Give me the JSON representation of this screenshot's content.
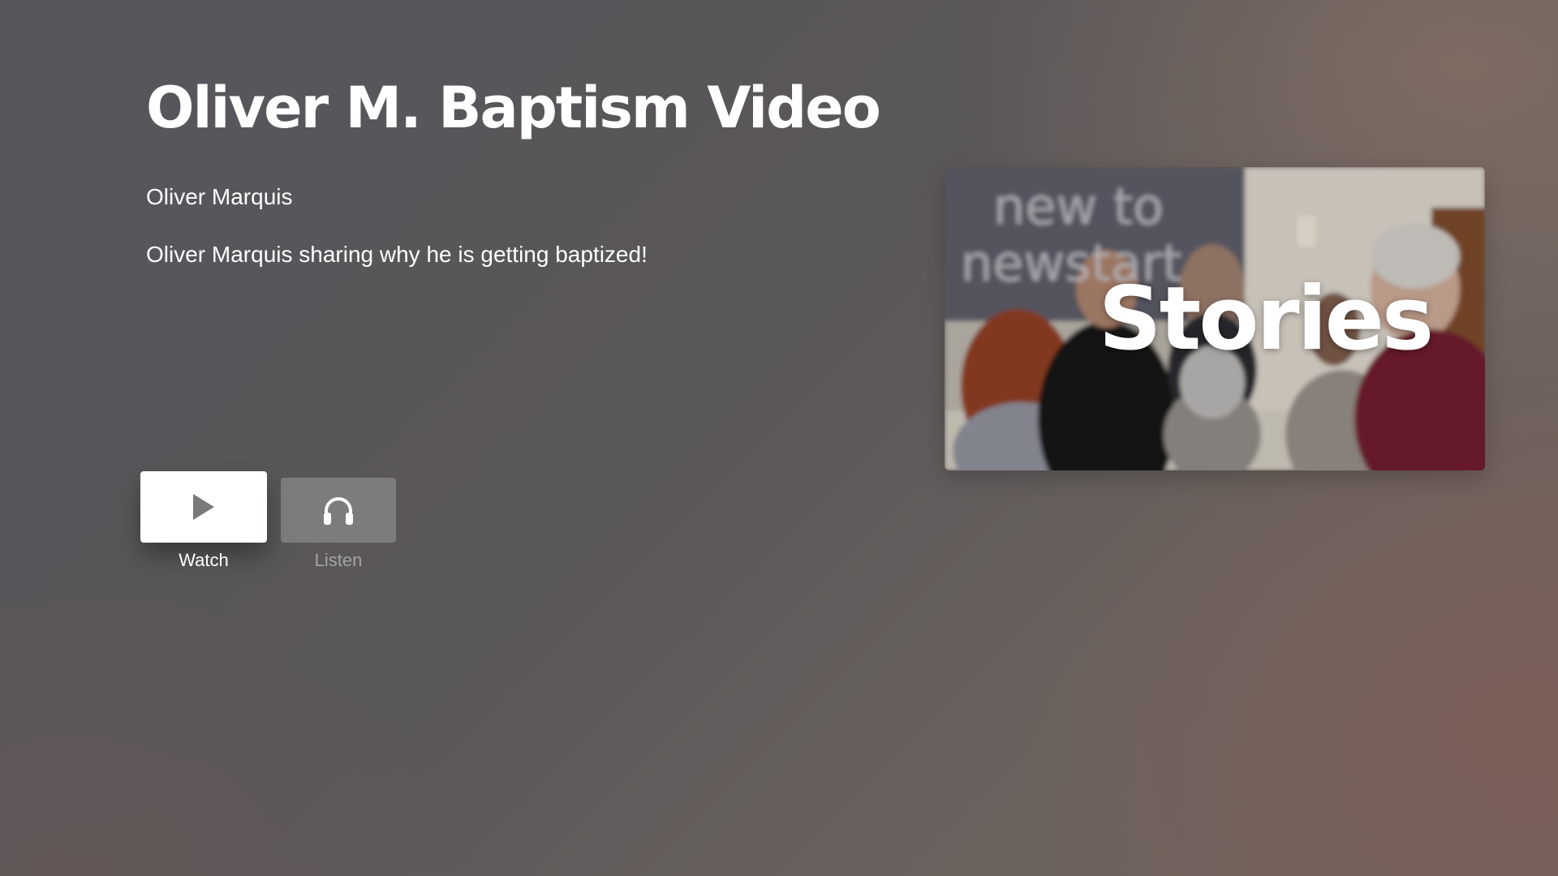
{
  "detail": {
    "title": "Oliver M. Baptism Video",
    "author": "Oliver Marquis",
    "description": "Oliver Marquis sharing why he is getting baptized!"
  },
  "actions": {
    "watch": {
      "label": "Watch",
      "icon": "play-icon"
    },
    "listen": {
      "label": "Listen",
      "icon": "headphones-icon"
    }
  },
  "artwork": {
    "title": "Stories",
    "banner_text": "new to newstart"
  },
  "colors": {
    "background": "#5a5759",
    "background_warm": "#74625c",
    "focused_button": "#ffffff",
    "unfocused_button": "rgba(255,255,255,0.22)"
  }
}
